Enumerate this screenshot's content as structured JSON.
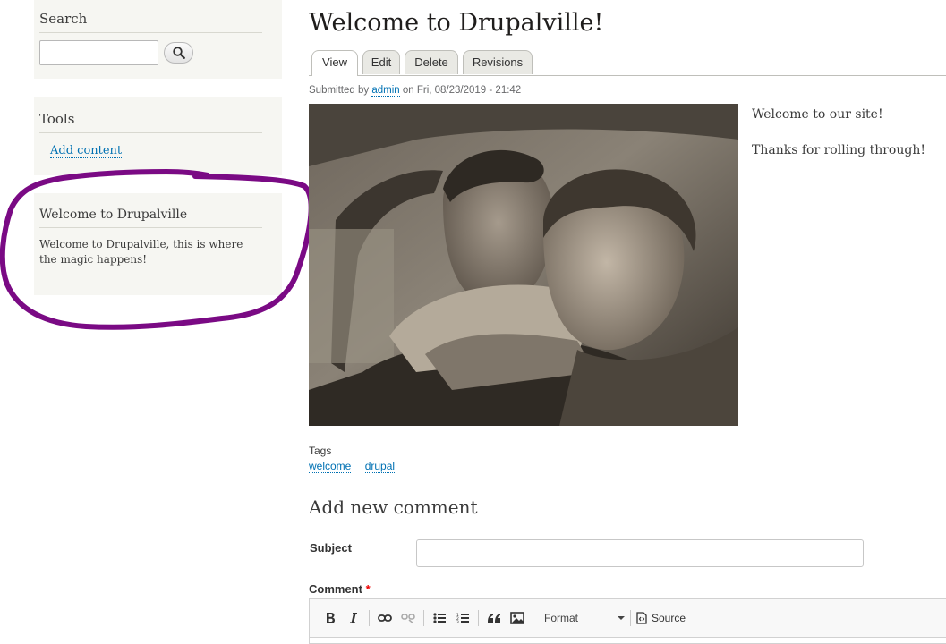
{
  "sidebar": {
    "search": {
      "title": "Search",
      "input_value": ""
    },
    "tools": {
      "title": "Tools",
      "links": [
        "Add content"
      ]
    },
    "welcome": {
      "title": "Welcome to Drupalville",
      "body": "Welcome to Drupalville, this is where the magic happens!"
    }
  },
  "annotation": {
    "color": "#7a0a84"
  },
  "main": {
    "title": "Welcome to Drupalville!",
    "tabs": [
      {
        "label": "View",
        "active": true
      },
      {
        "label": "Edit",
        "active": false
      },
      {
        "label": "Delete",
        "active": false
      },
      {
        "label": "Revisions",
        "active": false
      }
    ],
    "submitted": {
      "prefix": "Submitted by",
      "author": "admin",
      "date": "on Fri, 08/23/2019 - 21:42"
    },
    "body": [
      "Welcome to our site!",
      "Thanks for rolling through!"
    ],
    "tags": {
      "label": "Tags",
      "items": [
        "welcome",
        "drupal"
      ]
    }
  },
  "comment_form": {
    "heading": "Add new comment",
    "subject_label": "Subject",
    "subject_value": "",
    "comment_label": "Comment",
    "required_marker": "*",
    "toolbar": {
      "format_label": "Format",
      "source_label": "Source"
    }
  }
}
